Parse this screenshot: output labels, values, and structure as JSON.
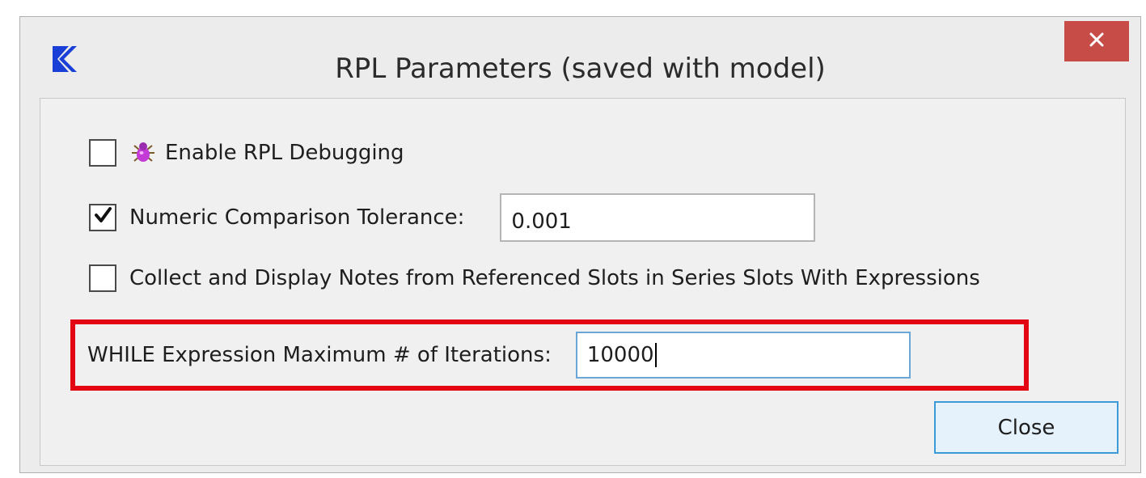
{
  "window": {
    "title": "RPL Parameters (saved with model)",
    "app_icon": "riverware-r-icon",
    "close_icon": "close-icon"
  },
  "options": {
    "debugging": {
      "label": "Enable RPL Debugging",
      "checked": false,
      "icon": "bug-icon"
    },
    "tolerance": {
      "label": "Numeric Comparison Tolerance:",
      "checked": true,
      "value": "0.001"
    },
    "notes": {
      "label": "Collect and Display Notes from Referenced Slots in Series Slots With Expressions",
      "checked": false
    },
    "while_iterations": {
      "label": "WHILE Expression Maximum # of Iterations:",
      "value": "10000"
    }
  },
  "buttons": {
    "close_label": "Close"
  },
  "colors": {
    "highlight": "#e30613",
    "close_x_bg": "#c74b47",
    "button_border": "#3c9ad8"
  }
}
